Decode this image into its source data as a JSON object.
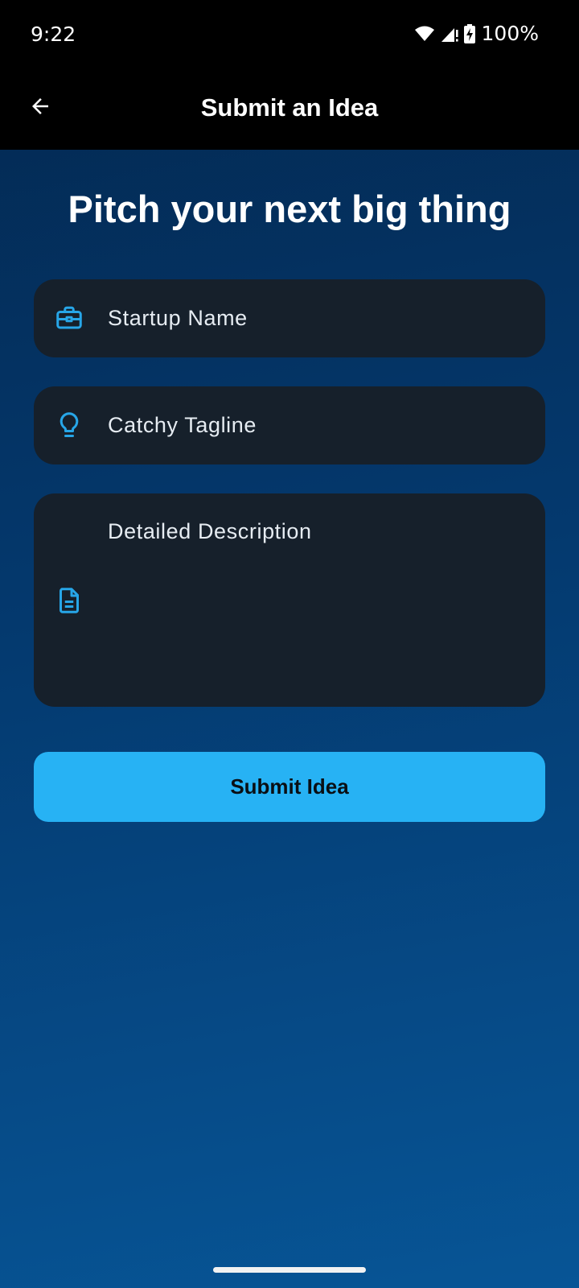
{
  "status_bar": {
    "time": "9:22",
    "battery": "100%",
    "icons": [
      "wifi-icon",
      "signal-icon",
      "battery-charging-icon"
    ]
  },
  "app_bar": {
    "title": "Submit an Idea",
    "back_icon": "arrow-back-icon"
  },
  "headline": "Pitch your next big thing",
  "form": {
    "startup_name": {
      "placeholder": "Startup Name",
      "icon": "briefcase-icon"
    },
    "tagline": {
      "placeholder": "Catchy Tagline",
      "icon": "lightbulb-icon"
    },
    "description": {
      "placeholder": "Detailed Description",
      "icon": "document-icon"
    },
    "submit_label": "Submit Idea"
  },
  "colors": {
    "accent": "#27B2F4",
    "field_bg": "#16202B",
    "icon": "#27A6E8",
    "bar_bg": "#000000"
  }
}
